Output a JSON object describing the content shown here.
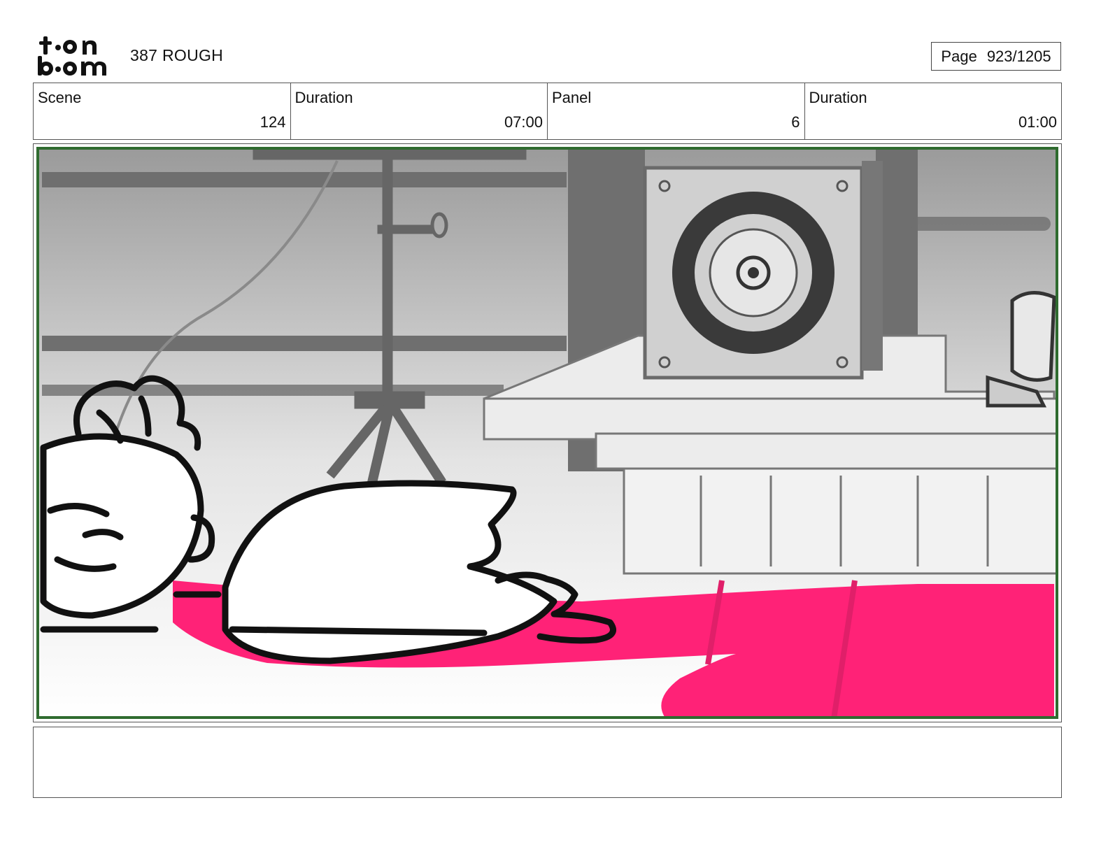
{
  "header": {
    "logo_text": "toon boom",
    "title": "387 ROUGH",
    "page_label": "Page",
    "page_value": "923/1205"
  },
  "info_bar": {
    "scene_label": "Scene",
    "scene_value": "124",
    "scene_duration_label": "Duration",
    "scene_duration_value": "07:00",
    "panel_label": "Panel",
    "panel_value": "6",
    "panel_duration_label": "Duration",
    "panel_duration_value": "01:00"
  },
  "panel": {
    "colors": {
      "accent_pink": "#ff2277",
      "frame_green": "#2f6b2f",
      "sketch_gray": "#777777"
    }
  },
  "notes": {
    "text": ""
  }
}
